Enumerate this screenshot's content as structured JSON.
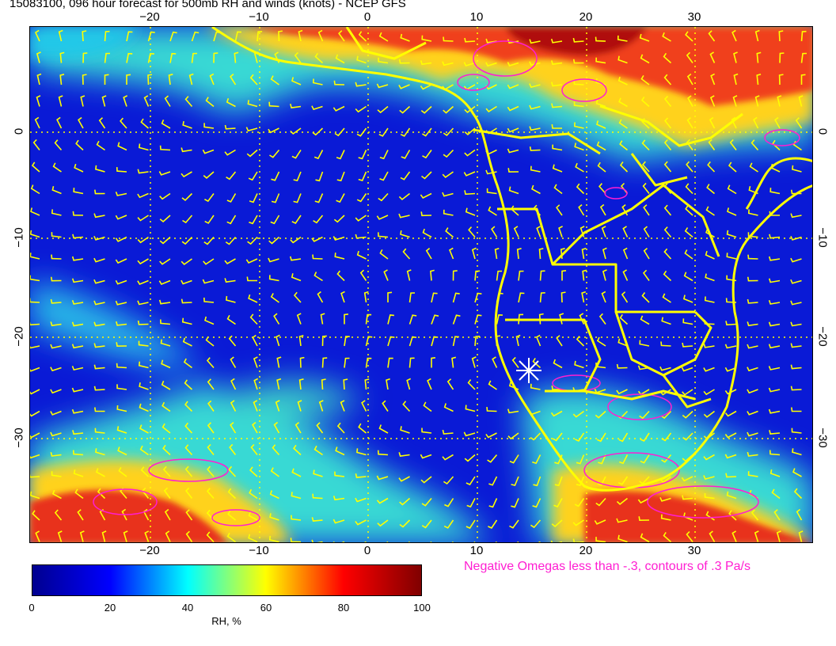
{
  "title": "15083100, 096 hour forecast for 500mb RH and winds (knots) - NCEP GFS",
  "longitude_ticks": [
    "−20",
    "−10",
    "0",
    "10",
    "20",
    "30"
  ],
  "latitude_ticks": [
    "0",
    "−10",
    "−20",
    "−30"
  ],
  "omega_note": "Negative Omegas less than -.3, contours of .3 Pa/s",
  "colorbar": {
    "label": "RH, %",
    "ticks": [
      "0",
      "20",
      "40",
      "60",
      "80",
      "100"
    ],
    "stops": [
      "#00008f",
      "#0000ff",
      "#00ffff",
      "#ffff00",
      "#ff0000",
      "#800000"
    ]
  },
  "colors": {
    "coastline": "#ffff00",
    "wind_barbs": "#ffff00",
    "omega_contours": "#ff1ed2",
    "grid": "#ffff00",
    "marker": "#ffffff"
  }
}
